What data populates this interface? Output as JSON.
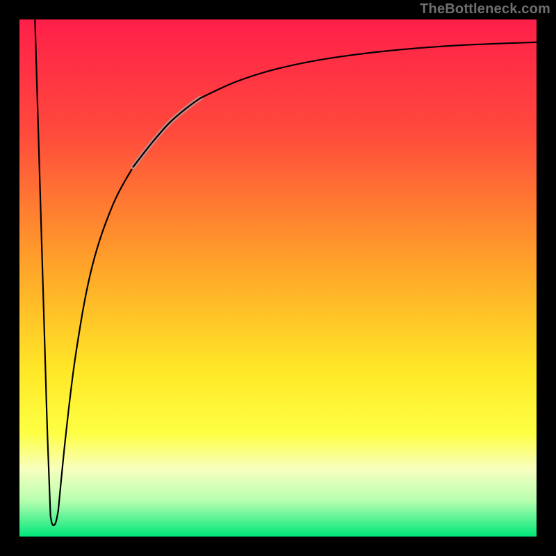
{
  "watermark": "TheBottleneck.com",
  "chart_data": {
    "type": "line",
    "title": "",
    "xlabel": "",
    "ylabel": "",
    "xlim": [
      0,
      100
    ],
    "ylim": [
      0,
      100
    ],
    "background_gradient_stops": [
      {
        "offset": 0,
        "color": "#ff1f4a"
      },
      {
        "offset": 0.22,
        "color": "#ff4a3c"
      },
      {
        "offset": 0.48,
        "color": "#ffa529"
      },
      {
        "offset": 0.68,
        "color": "#ffe827"
      },
      {
        "offset": 0.8,
        "color": "#feff43"
      },
      {
        "offset": 0.87,
        "color": "#f7ffbf"
      },
      {
        "offset": 0.93,
        "color": "#b8ffb0"
      },
      {
        "offset": 1.0,
        "color": "#00e77a"
      }
    ],
    "series": [
      {
        "name": "drop",
        "color": "#000000",
        "width": 2.2,
        "points": [
          {
            "x": 3.0,
            "y": 100
          },
          {
            "x": 3.6,
            "y": 80
          },
          {
            "x": 4.2,
            "y": 60
          },
          {
            "x": 4.8,
            "y": 40
          },
          {
            "x": 5.4,
            "y": 20
          },
          {
            "x": 6.0,
            "y": 4
          }
        ]
      },
      {
        "name": "dip-bottom",
        "color": "#000000",
        "width": 2.2,
        "points": [
          {
            "x": 6.0,
            "y": 4
          },
          {
            "x": 6.3,
            "y": 2.5
          },
          {
            "x": 6.7,
            "y": 2.2
          },
          {
            "x": 7.1,
            "y": 3.0
          },
          {
            "x": 7.5,
            "y": 5.0
          }
        ]
      },
      {
        "name": "rise-lower",
        "color": "#000000",
        "width": 2.2,
        "points": [
          {
            "x": 7.5,
            "y": 5.0
          },
          {
            "x": 9.0,
            "y": 20
          },
          {
            "x": 11.0,
            "y": 36
          },
          {
            "x": 14.0,
            "y": 52
          },
          {
            "x": 18.0,
            "y": 64
          },
          {
            "x": 22.0,
            "y": 71.5
          }
        ]
      },
      {
        "name": "rise-highlight",
        "color": "#c88882",
        "width": 7,
        "points": [
          {
            "x": 22.0,
            "y": 71.5
          },
          {
            "x": 25.5,
            "y": 76.0
          },
          {
            "x": 29.0,
            "y": 80.0
          },
          {
            "x": 32.5,
            "y": 83.0
          },
          {
            "x": 35.0,
            "y": 84.8
          }
        ]
      },
      {
        "name": "rise-highlight-core",
        "color": "#000000",
        "width": 2.2,
        "points": [
          {
            "x": 22.0,
            "y": 71.5
          },
          {
            "x": 25.5,
            "y": 76.0
          },
          {
            "x": 29.0,
            "y": 80.0
          },
          {
            "x": 32.5,
            "y": 83.0
          },
          {
            "x": 35.0,
            "y": 84.8
          }
        ]
      },
      {
        "name": "rise-upper",
        "color": "#000000",
        "width": 2.2,
        "points": [
          {
            "x": 35.0,
            "y": 84.8
          },
          {
            "x": 42.0,
            "y": 88.0
          },
          {
            "x": 50.0,
            "y": 90.5
          },
          {
            "x": 60.0,
            "y": 92.5
          },
          {
            "x": 72.0,
            "y": 94.0
          },
          {
            "x": 85.0,
            "y": 95.0
          },
          {
            "x": 100.0,
            "y": 95.6
          }
        ]
      }
    ]
  }
}
